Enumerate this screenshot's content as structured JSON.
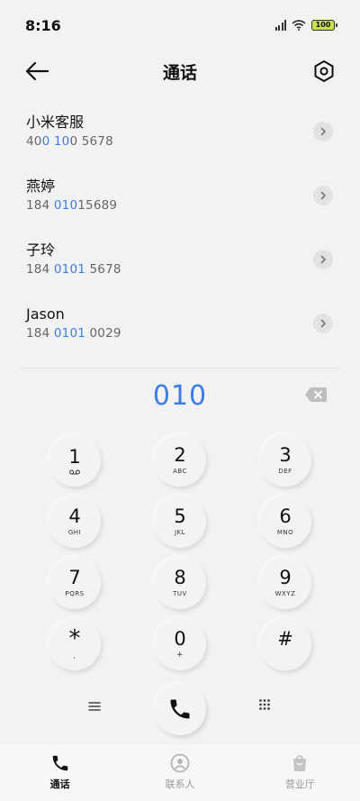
{
  "status_bar": {
    "time": "8:16",
    "battery": "100",
    "battery_color": "#c7e24a"
  },
  "header": {
    "title": "通话",
    "back_icon": "arrow-left-icon",
    "settings_icon": "hexagon-settings-icon"
  },
  "contacts": [
    {
      "name": "小米客服",
      "number_parts": [
        "40",
        "0 10",
        "0 5678"
      ]
    },
    {
      "name": "燕婷",
      "number_parts": [
        "184 ",
        "010",
        "15689"
      ]
    },
    {
      "name": "子玲",
      "number_parts": [
        "184 ",
        "0101",
        " 5678"
      ]
    },
    {
      "name": "Jason",
      "number_parts": [
        "184 ",
        "0101",
        " 0029"
      ]
    }
  ],
  "dialer": {
    "input_value": "010",
    "highlight_color": "#3b7de6",
    "keys": [
      {
        "digit": "1",
        "letters": "voicemail-icon",
        "is_icon": true
      },
      {
        "digit": "2",
        "letters": "ABC"
      },
      {
        "digit": "3",
        "letters": "DEF"
      },
      {
        "digit": "4",
        "letters": "GHI"
      },
      {
        "digit": "5",
        "letters": "JKL"
      },
      {
        "digit": "6",
        "letters": "MNO"
      },
      {
        "digit": "7",
        "letters": "PQRS"
      },
      {
        "digit": "8",
        "letters": "TUV"
      },
      {
        "digit": "9",
        "letters": "WXYZ"
      },
      {
        "digit": "*",
        "letters": ","
      },
      {
        "digit": "0",
        "letters": "+"
      },
      {
        "digit": "#",
        "letters": ""
      }
    ]
  },
  "bottom_nav": [
    {
      "label": "通话",
      "icon": "phone-icon",
      "active": true
    },
    {
      "label": "联系人",
      "icon": "contacts-icon",
      "active": false
    },
    {
      "label": "营业厅",
      "icon": "shopping-bag-icon",
      "active": false
    }
  ]
}
